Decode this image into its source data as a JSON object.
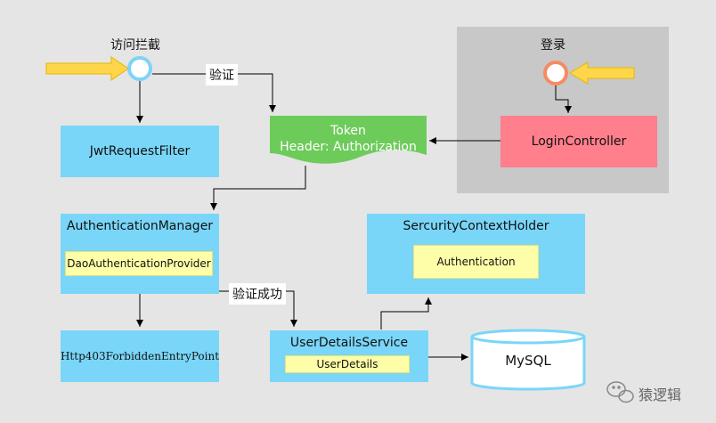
{
  "labels": {
    "intercept": "访问拦截",
    "login": "登录",
    "verify": "验证",
    "verify_success": "验证成功"
  },
  "nodes": {
    "jwt_filter": "JwtRequestFilter",
    "token_line1": "Token",
    "token_line2": "Header: Authorization",
    "login_controller": "LoginController",
    "auth_manager": "AuthenticationManager",
    "dao_provider": "DaoAuthenticationProvider",
    "context_holder": "SercurityContextHolder",
    "authentication": "Authentication",
    "forbidden_entry": "Http403ForbiddenEntryPoint",
    "user_details_service": "UserDetailsService",
    "user_details": "UserDetails",
    "mysql": "MySQL"
  },
  "watermark": {
    "text": "猿逻辑"
  },
  "colors": {
    "background": "#e5e5e5",
    "login_panel": "#c8c8c8",
    "blue_box": "#79d6f8",
    "yellow_box": "#fffea8",
    "green_token": "#6dcb5a",
    "pink_login": "#ff7f8c",
    "arrow_fill": "#ffd54a"
  }
}
